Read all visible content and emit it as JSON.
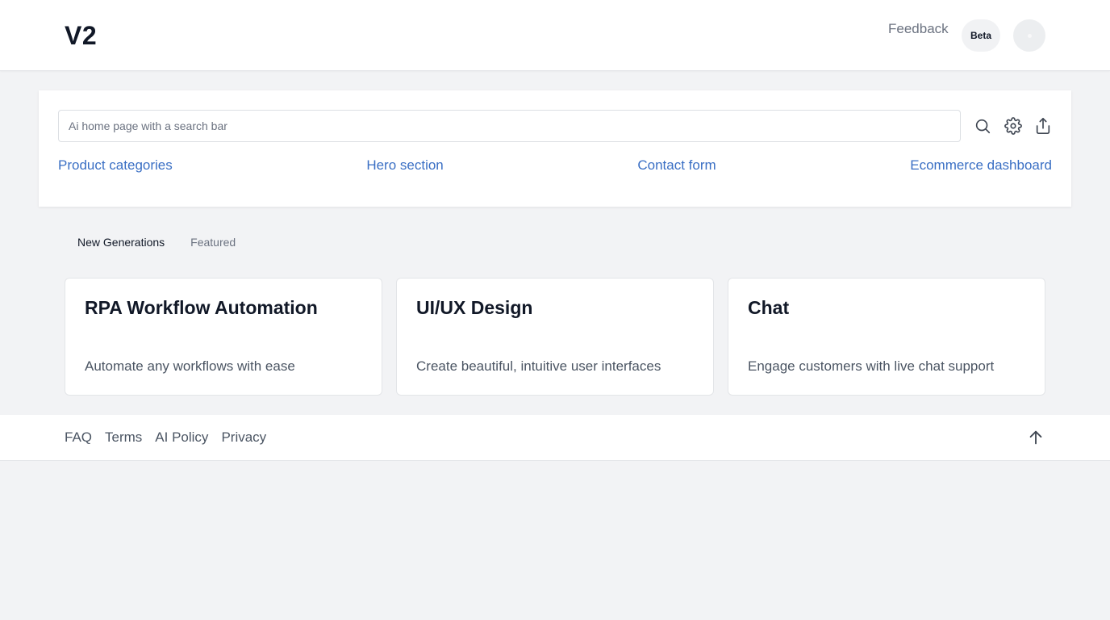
{
  "header": {
    "logo": "V2",
    "feedback_label": "Feedback",
    "beta_label": "Beta"
  },
  "search": {
    "placeholder": "Ai home page with a search bar",
    "value": "",
    "icons": [
      "search-icon",
      "gear-icon",
      "share-icon"
    ],
    "suggestions": [
      {
        "label": "Product categories"
      },
      {
        "label": "Hero section"
      },
      {
        "label": "Contact form"
      },
      {
        "label": "Ecommerce dashboard"
      }
    ]
  },
  "tabs": [
    {
      "label": "New Generations",
      "active": true
    },
    {
      "label": "Featured",
      "active": false
    }
  ],
  "cards": [
    {
      "title": "RPA Workflow Automation",
      "description": "Automate any workflows with ease"
    },
    {
      "title": "UI/UX Design",
      "description": "Create beautiful, intuitive user interfaces"
    },
    {
      "title": "Chat",
      "description": "Engage customers with live chat support"
    }
  ],
  "footer": {
    "links": [
      {
        "label": "FAQ"
      },
      {
        "label": "Terms"
      },
      {
        "label": "AI Policy"
      },
      {
        "label": "Privacy"
      }
    ],
    "scroll_top_icon": "arrow-up-icon"
  },
  "colors": {
    "link": "#3a6fc4",
    "background": "#f2f3f5",
    "surface": "#ffffff"
  }
}
